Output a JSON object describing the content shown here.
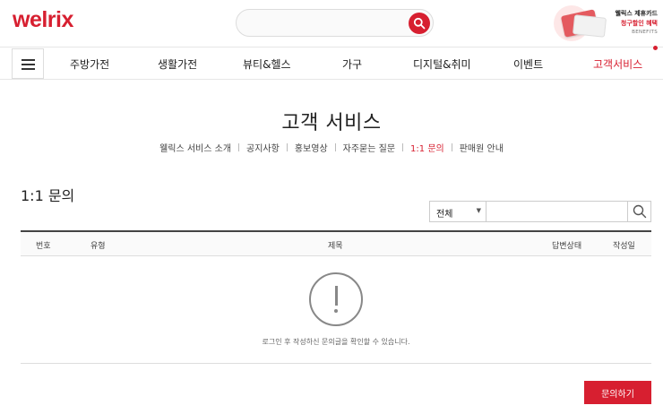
{
  "header": {
    "logo": "welrix",
    "search": {
      "placeholder": "",
      "value": ""
    },
    "banner": {
      "line1": "웰릭스 제휴카드",
      "line2": "청구할인 혜택",
      "line3": "BENEFITS"
    }
  },
  "nav": {
    "items": [
      {
        "label": "주방가전"
      },
      {
        "label": "생활가전"
      },
      {
        "label": "뷰티&헬스"
      },
      {
        "label": "가구"
      },
      {
        "label": "디지털&취미"
      },
      {
        "label": "이벤트"
      },
      {
        "label": "고객서비스",
        "active": true
      }
    ]
  },
  "page": {
    "title": "고객 서비스",
    "subnav": [
      {
        "label": "웰릭스 서비스 소개"
      },
      {
        "label": "공지사항"
      },
      {
        "label": "홍보영상"
      },
      {
        "label": "자주묻는 질문"
      },
      {
        "label": "1:1 문의",
        "active": true
      },
      {
        "label": "판매원 안내"
      }
    ],
    "section_title": "1:1 문의",
    "filter": {
      "selected": "전체",
      "placeholder": "",
      "value": ""
    },
    "table": {
      "columns": [
        "번호",
        "유형",
        "제목",
        "답변상태",
        "작성일"
      ],
      "empty_message": "로그인 후 작성하신 문의글을 확인할 수 있습니다."
    },
    "inquiry_button": "문의하기"
  },
  "colors": {
    "brand": "#d71f30"
  },
  "icons": {
    "search": "search-icon",
    "menu": "hamburger-menu-icon",
    "empty": "exclamation-circle-icon"
  }
}
